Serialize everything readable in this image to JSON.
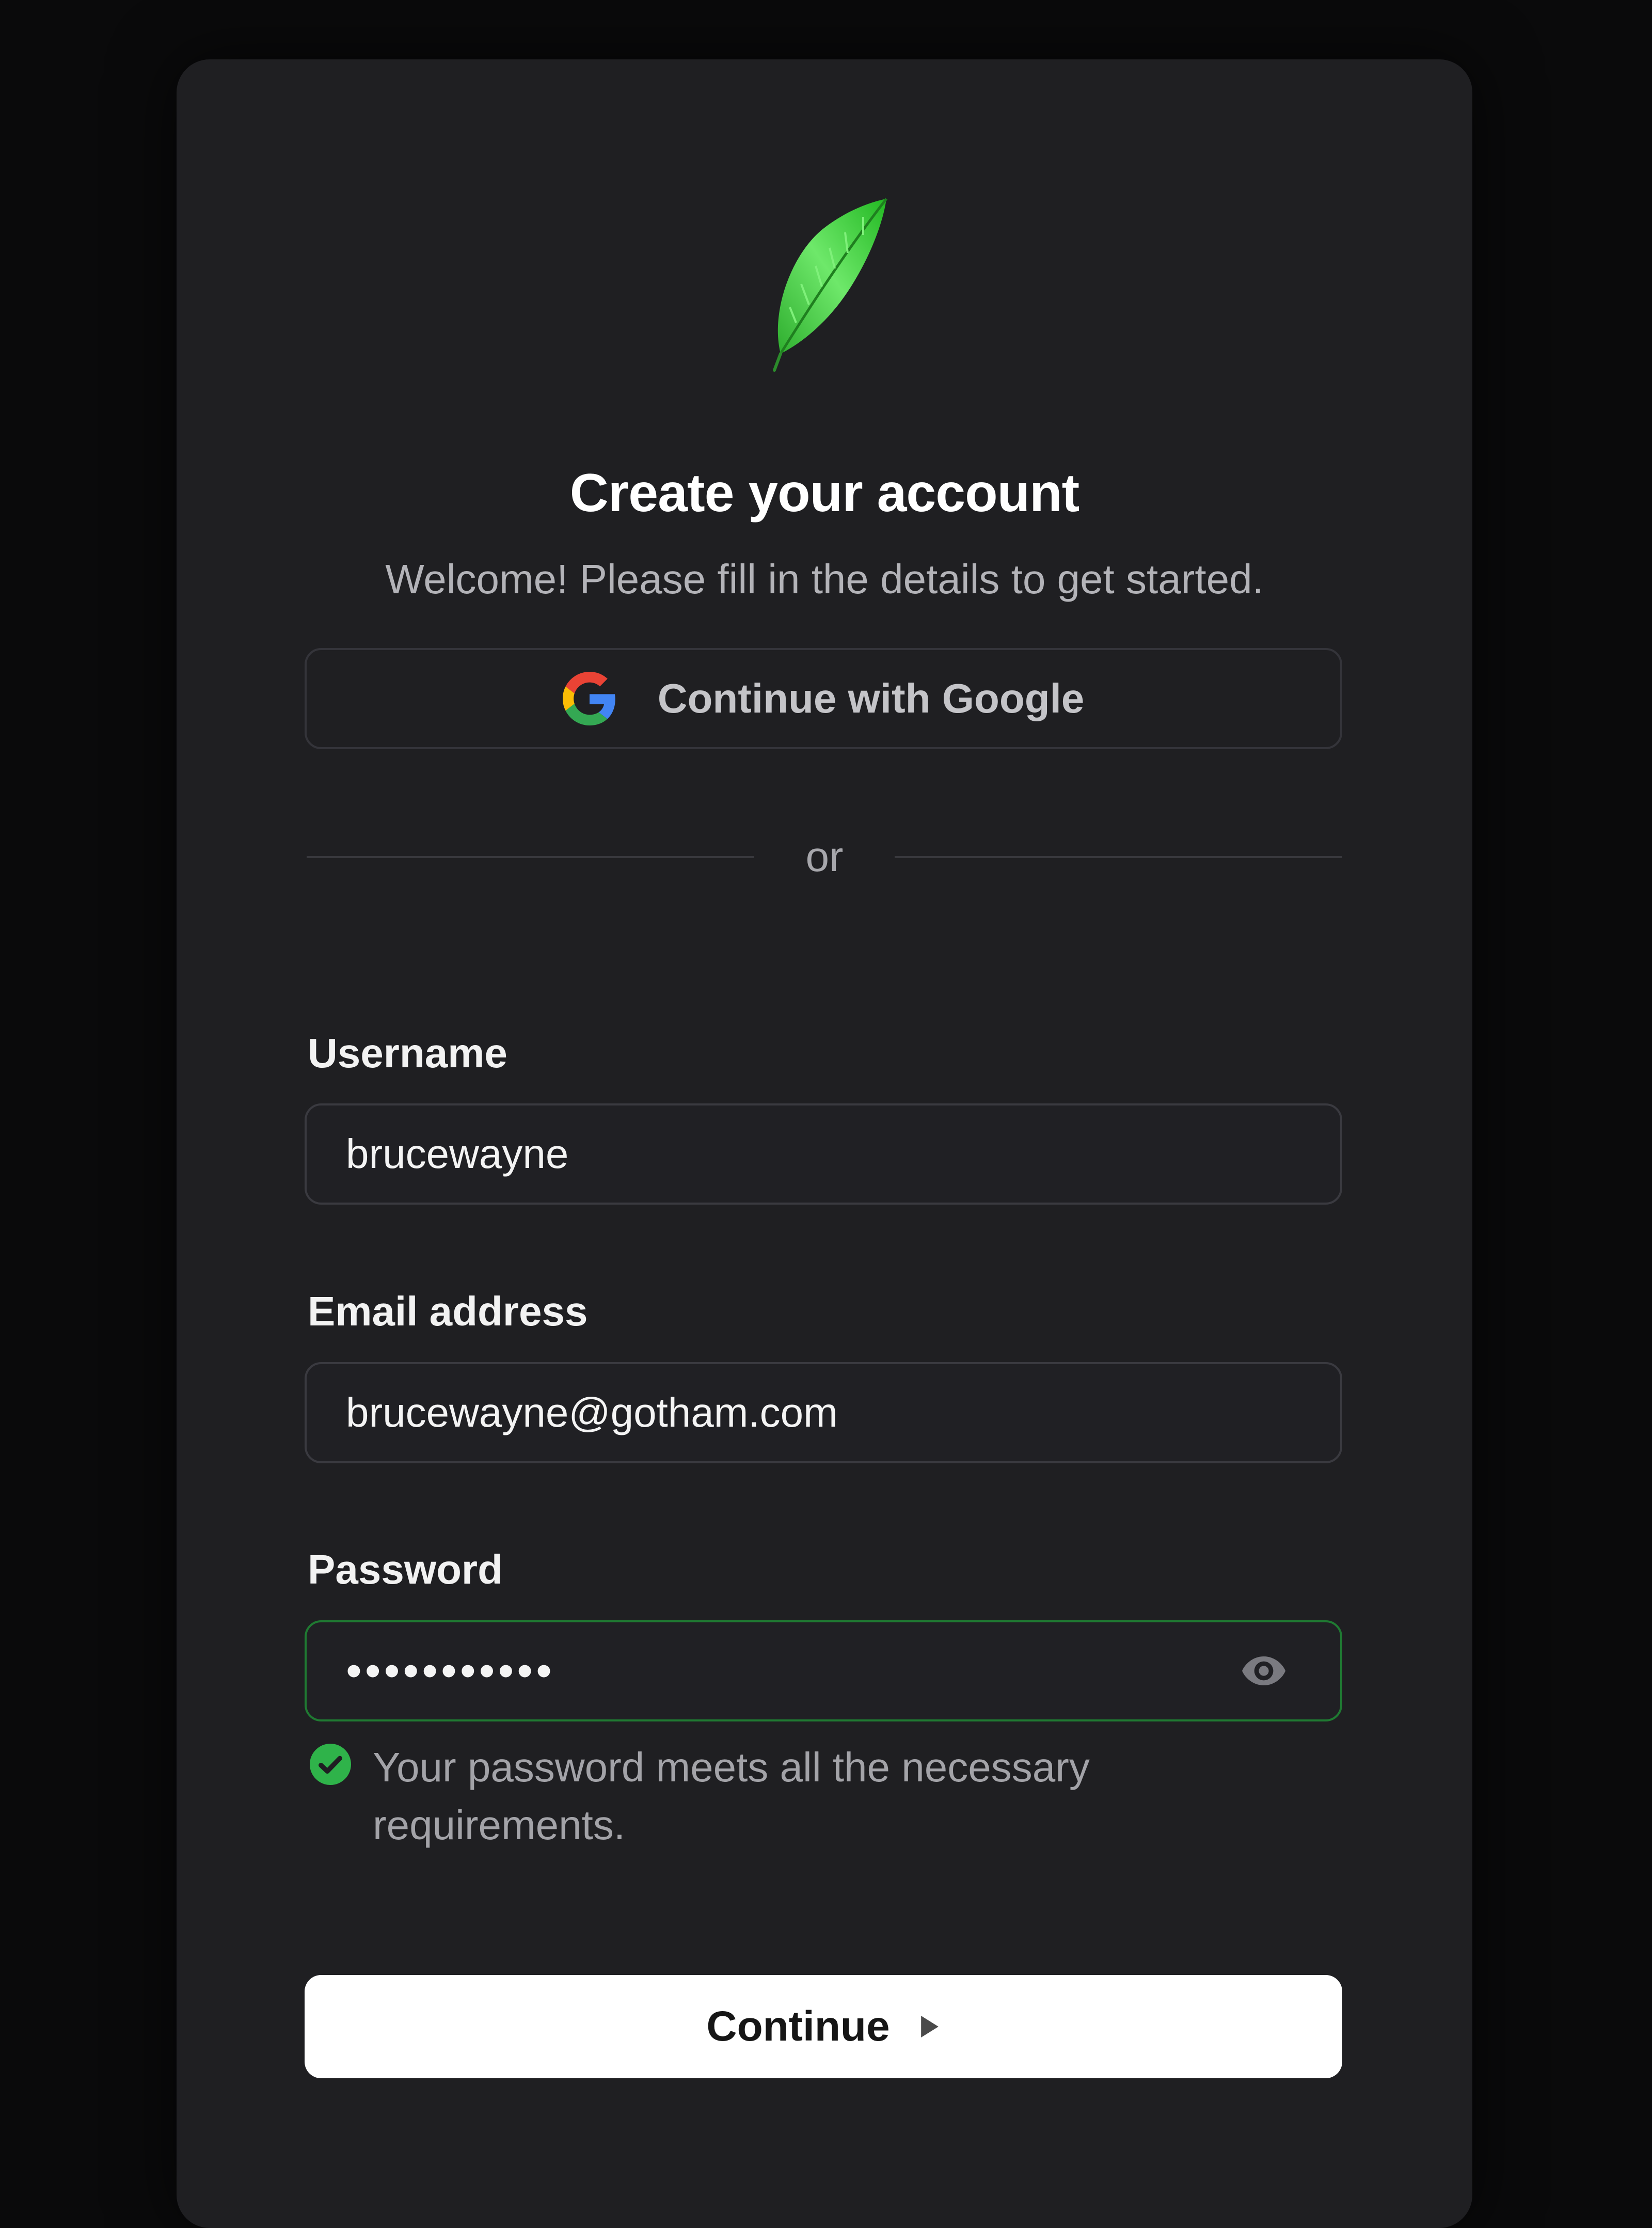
{
  "header": {
    "logo_icon": "green-feather-icon",
    "title": "Create your account",
    "subtitle": "Welcome! Please fill in the details to get started."
  },
  "social": {
    "google_label": "Continue with Google",
    "google_icon": "google-g-icon"
  },
  "divider": {
    "text": "or"
  },
  "form": {
    "username": {
      "label": "Username",
      "value": "brucewayne"
    },
    "email": {
      "label": "Email address",
      "value": "brucewayne@gotham.com"
    },
    "password": {
      "label": "Password",
      "value": "•••••••••••",
      "toggle_icon": "eye-icon",
      "hint": "Your password meets all the necessary requirements.",
      "hint_icon": "check-circle-icon"
    }
  },
  "actions": {
    "continue_label": "Continue",
    "continue_icon": "play-arrow-icon"
  },
  "colors": {
    "background": "#0a0a0b",
    "card": "#1f1f22",
    "success": "#2fb34a",
    "primary_button": "#ffffff"
  }
}
